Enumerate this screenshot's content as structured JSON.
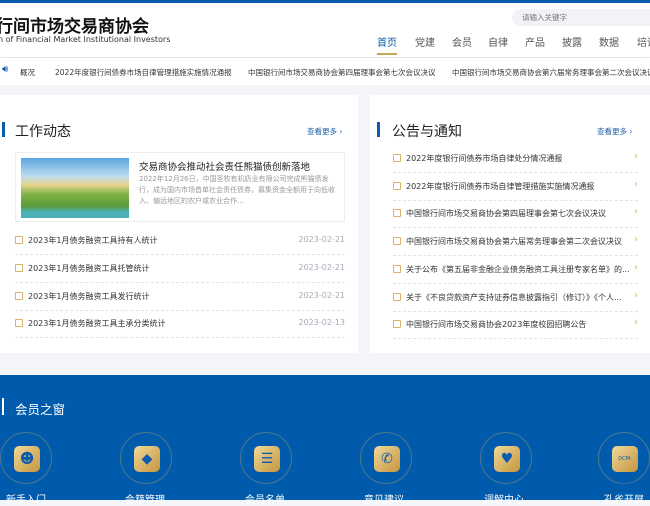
{
  "header": {
    "logo": "行间市场交易商协会",
    "logo_sub": "n of Financial Market Institutional Investors",
    "search_placeholder": "请输入关键字",
    "nav": [
      "首页",
      "党建",
      "会员",
      "自律",
      "产品",
      "披露",
      "数据",
      "培训"
    ]
  },
  "ticker": {
    "label": "概况",
    "items": [
      "2022年度银行间债券市场自律管理措施实施情况通报",
      "中国银行间市场交易商协会第四届理事会第七次会议决议",
      "中国银行间市场交易商协会第六届常务理事会第二次会议决议"
    ]
  },
  "work": {
    "title": "工作动态",
    "more": "查看更多 ›",
    "feature": {
      "title": "交易商协会推动社会责任熊猫债创新落地",
      "desc": "2022年12月26日，中国圣牧有机奶业有限公司完成熊猫债发行，成为国内市场首单社会责任债券，募集资金全额用于向低收入、偏远地区的农户或农业合作..."
    },
    "items": [
      {
        "t": "2023年1月债务融资工具持有人统计",
        "d": "2023-02-21"
      },
      {
        "t": "2023年1月债务融资工具托管统计",
        "d": "2023-02-21"
      },
      {
        "t": "2023年1月债务融资工具发行统计",
        "d": "2023-02-21"
      },
      {
        "t": "2023年1月债务融资工具主承分类统计",
        "d": "2023-02-13"
      }
    ]
  },
  "notice": {
    "title": "公告与通知",
    "more": "查看更多 ›",
    "items": [
      "2022年度银行间债券市场自律处分情况通报",
      "2022年度银行间债券市场自律管理措施实施情况通报",
      "中国银行间市场交易商协会第四届理事会第七次会议决议",
      "中国银行间市场交易商协会第六届常务理事会第二次会议决议",
      "关于公布《第五届非金融企业债务融资工具注册专家名单》的...",
      "关于《不良贷款资产支持证券信息披露指引（修订）》《个人...",
      "中国银行间市场交易商协会2023年度校园招聘公告"
    ]
  },
  "members": {
    "title": "会员之窗",
    "items": [
      {
        "label": "新手入门",
        "icon": "☻"
      },
      {
        "label": "会籍管理",
        "icon": "◆"
      },
      {
        "label": "会员名单",
        "icon": "☰"
      },
      {
        "label": "意见建议",
        "icon": "✆"
      },
      {
        "label": "调解中心",
        "icon": "♥"
      },
      {
        "label": "孔雀开屏",
        "icon": "DCM-FANS"
      }
    ]
  }
}
